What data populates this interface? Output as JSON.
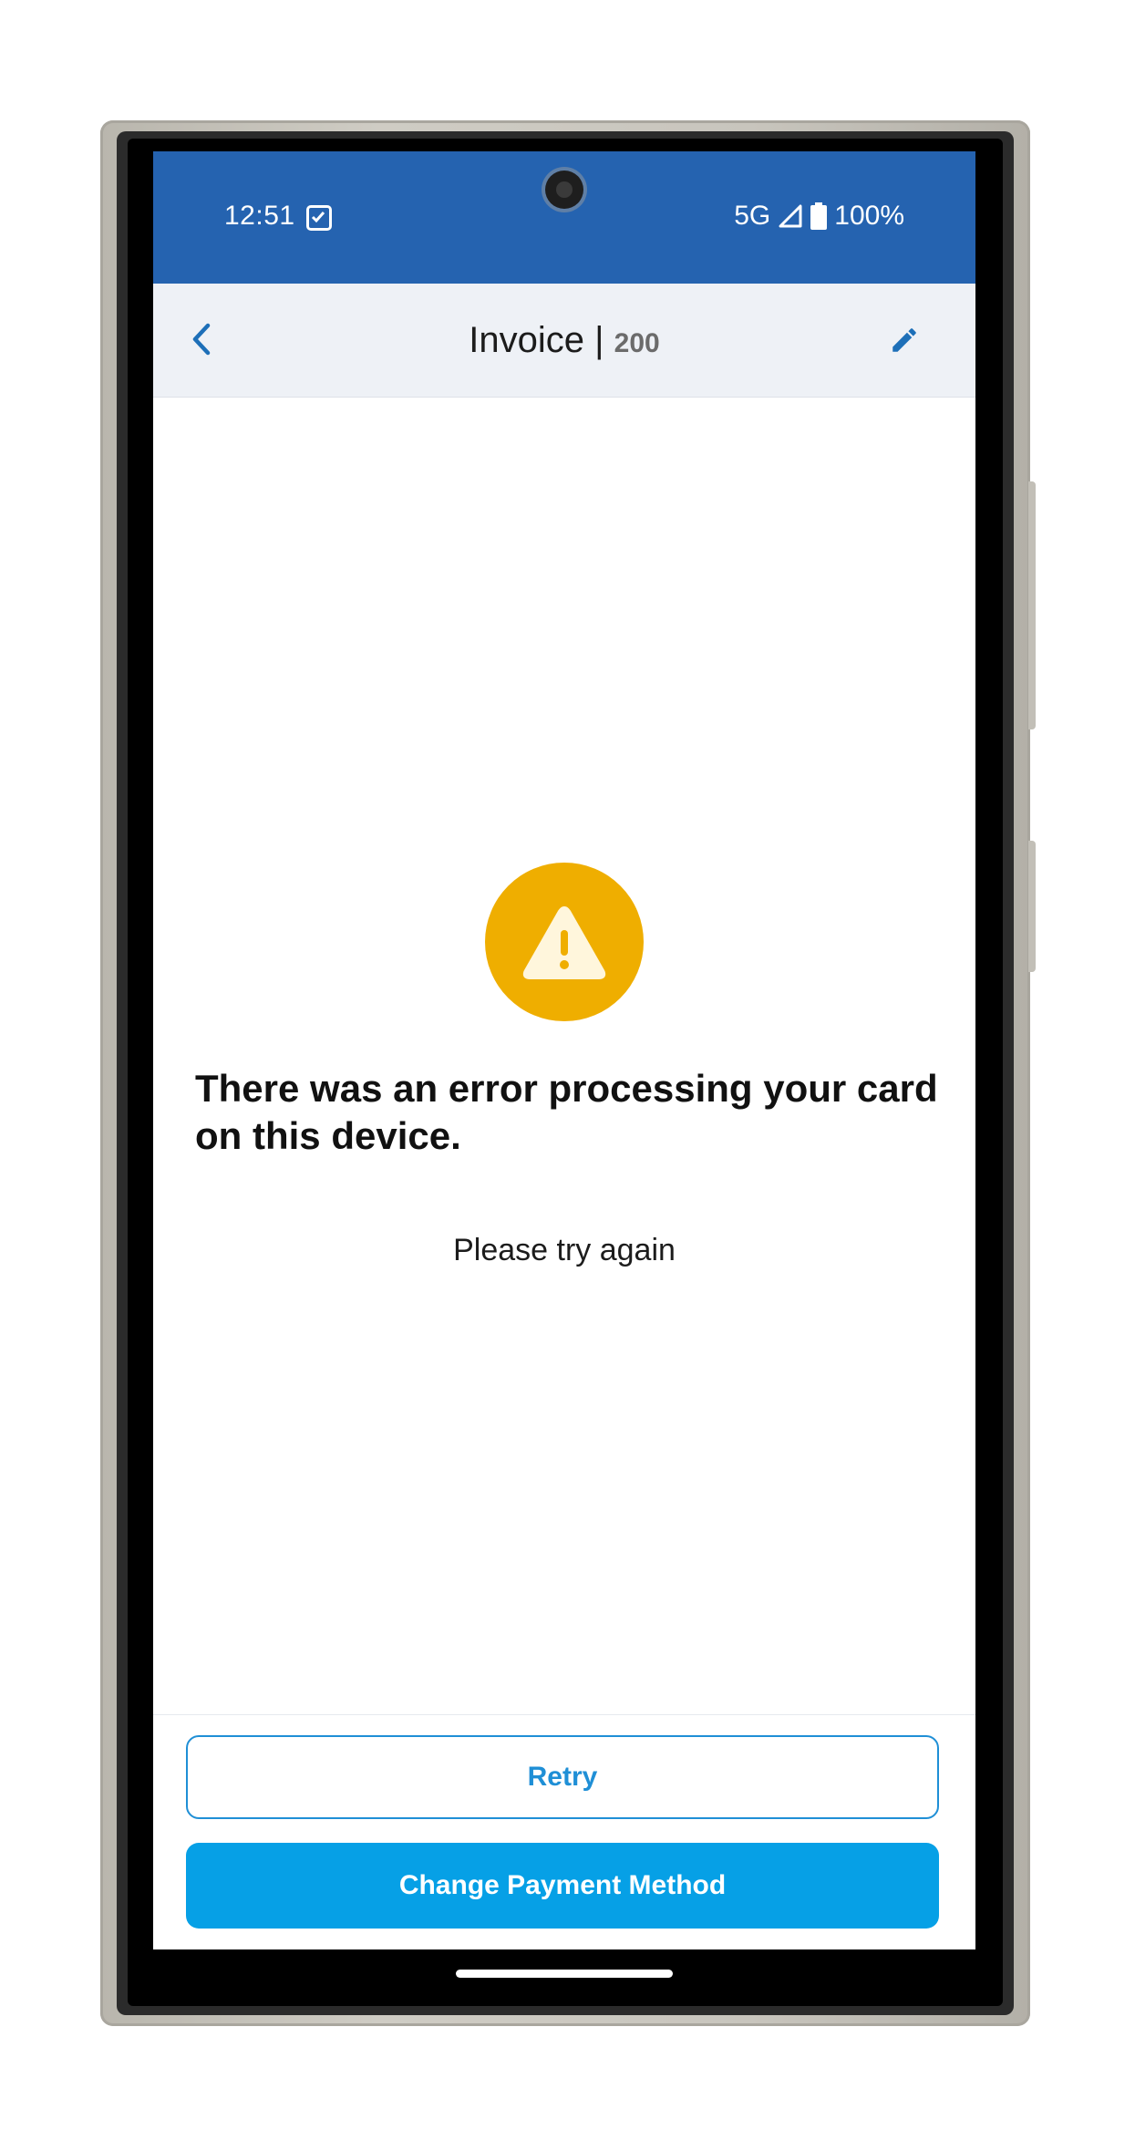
{
  "status_bar": {
    "time": "12:51",
    "network": "5G",
    "battery": "100%",
    "icons": [
      "task-check-icon",
      "signal-icon",
      "battery-icon"
    ]
  },
  "header": {
    "title": "Invoice |",
    "number": "200",
    "back_icon": "chevron-left-icon",
    "edit_icon": "pencil-icon"
  },
  "error": {
    "icon": "warning-triangle-icon",
    "heading": "There was an error processing your card on this device.",
    "subtext": "Please try again"
  },
  "actions": {
    "retry_label": "Retry",
    "change_payment_label": "Change Payment Method"
  },
  "colors": {
    "status_bar": "#2563b0",
    "accent": "#1f8fd6",
    "primary_button": "#06a0e6",
    "warning": "#efae00"
  }
}
